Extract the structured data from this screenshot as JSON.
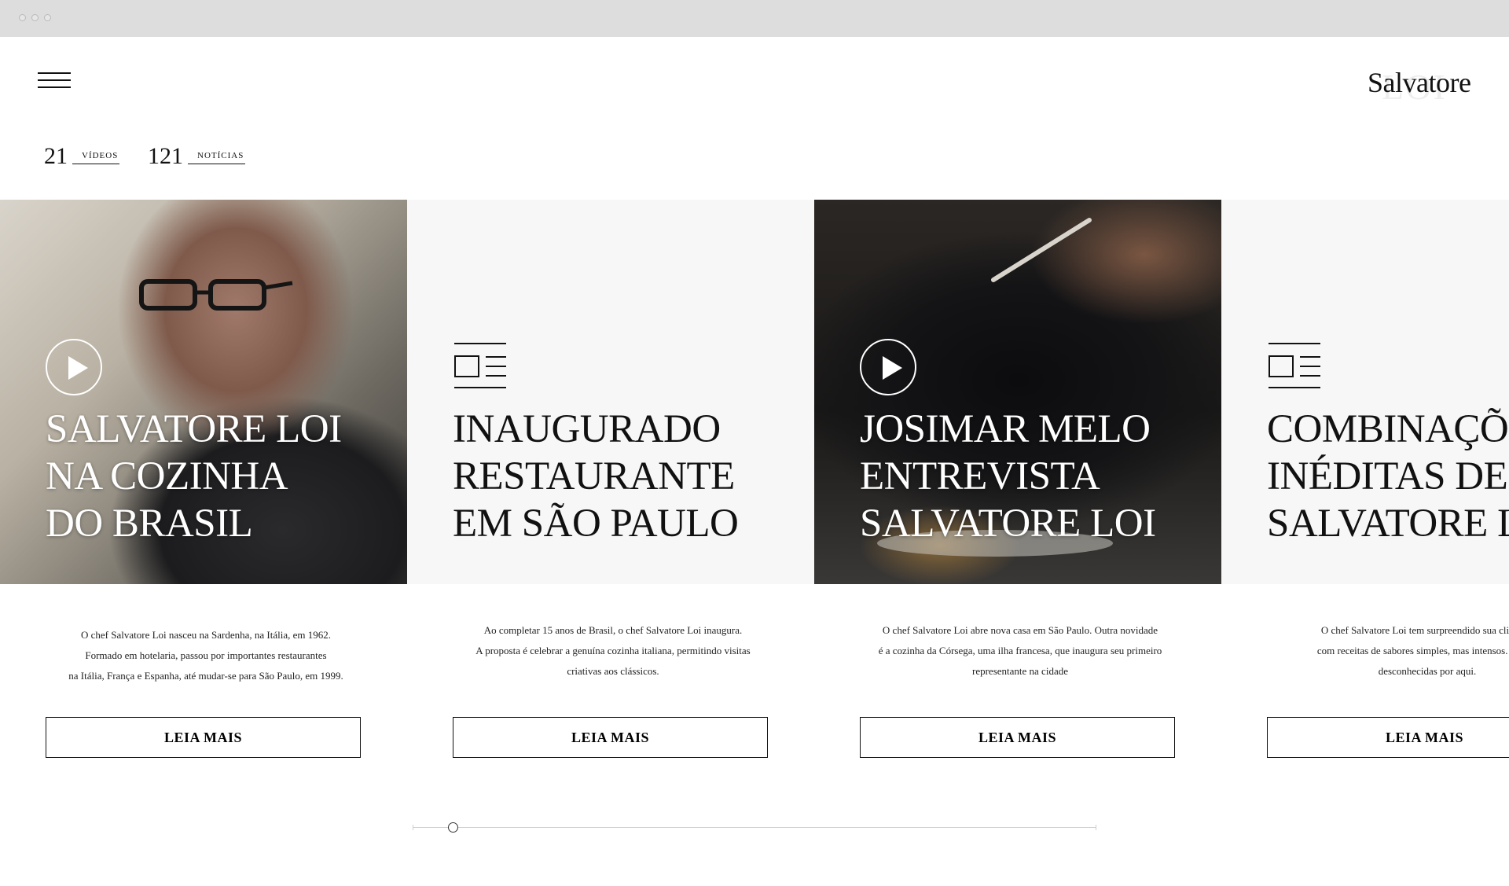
{
  "header": {
    "logo_text": "Salvatore",
    "logo_watermark": "LOI",
    "menu_icon": "hamburger-menu-icon"
  },
  "counters": [
    {
      "count": "21",
      "label": "VÍDEOS"
    },
    {
      "count": "121",
      "label": "NOTÍCIAS"
    }
  ],
  "cards": [
    {
      "type": "video",
      "icon": "play-icon",
      "title_lines": [
        "SALVATORE LOI",
        "NA COZINHA",
        "DO BRASIL"
      ],
      "description_lines": [
        "O chef Salvatore Loi nasceu na Sardenha, na Itália, em 1962.",
        "Formado em hotelaria, passou por importantes restaurantes",
        "na Itália, França e Espanha, até mudar-se para São Paulo, em 1999."
      ],
      "button_label": "LEIA MAIS"
    },
    {
      "type": "news",
      "icon": "news-icon",
      "title_lines": [
        "INAUGURADO",
        "RESTAURANTE",
        "EM SÃO PAULO"
      ],
      "description_lines": [
        "Ao completar 15 anos de Brasil, o chef Salvatore Loi inaugura.",
        "A proposta é celebrar a genuína cozinha italiana, permitindo visitas",
        "criativas aos clássicos."
      ],
      "button_label": "LEIA MAIS"
    },
    {
      "type": "video",
      "icon": "play-icon",
      "title_lines": [
        "JOSIMAR MELO",
        "ENTREVISTA",
        "SALVATORE LOI"
      ],
      "description_lines": [
        "O chef Salvatore Loi abre nova casa em São Paulo. Outra novidade",
        "é a cozinha da Córsega, uma ilha francesa, que inaugura seu primeiro",
        "representante na cidade"
      ],
      "button_label": "LEIA MAIS"
    },
    {
      "type": "news",
      "icon": "news-icon",
      "title_lines": [
        "COMBINAÇÕES",
        "INÉDITAS DE",
        "SALVATORE LOI"
      ],
      "description_lines": [
        "O chef Salvatore Loi tem surpreendido sua clientela",
        "com receitas de sabores simples, mas intensos. Vários",
        "desconhecidas por aqui."
      ],
      "button_label": "LEIA MAIS"
    }
  ],
  "carousel": {
    "position_fraction": 0.06
  }
}
